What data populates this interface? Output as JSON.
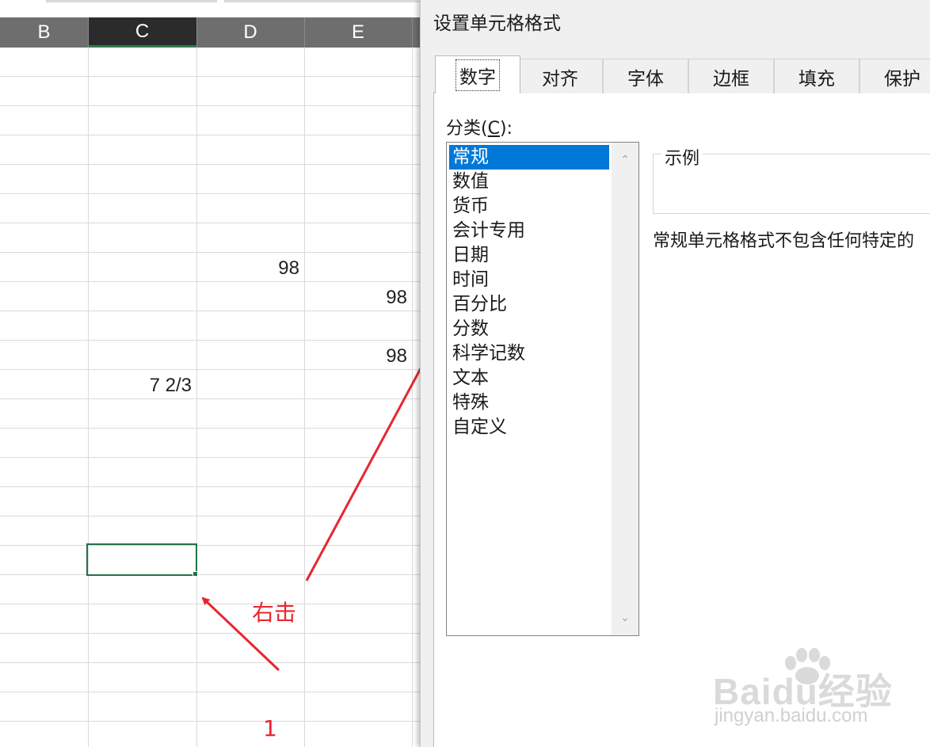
{
  "sheet": {
    "columns": [
      "B",
      "C",
      "D",
      "E"
    ],
    "active_column": "C",
    "cells": [
      {
        "ref": "D8",
        "value": "98"
      },
      {
        "ref": "E9",
        "value": "98"
      },
      {
        "ref": "E11",
        "value": "98"
      },
      {
        "ref": "C12",
        "value": "7 2/3"
      }
    ],
    "selected_cell": "C18"
  },
  "annotations": {
    "right_click": "右击",
    "step": "1",
    "color": "#e8262f"
  },
  "dialog": {
    "title": "设置单元格格式",
    "tabs": [
      "数字",
      "对齐",
      "字体",
      "边框",
      "填充",
      "保护"
    ],
    "active_tab": "数字",
    "category_label": "分类(",
    "category_label_key": "C",
    "category_label_end": "):",
    "categories": [
      "常规",
      "数值",
      "货币",
      "会计专用",
      "日期",
      "时间",
      "百分比",
      "分数",
      "科学记数",
      "文本",
      "特殊",
      "自定义"
    ],
    "selected_category": "常规",
    "sample_label": "示例",
    "description": "常规单元格格式不包含任何特定的"
  },
  "watermark": {
    "brand": "Baidu经验",
    "url": "jingyan.baidu.com"
  },
  "colors": {
    "selection_blue": "#0078d7",
    "excel_green": "#217346",
    "header_gray": "#6e6e6e"
  }
}
